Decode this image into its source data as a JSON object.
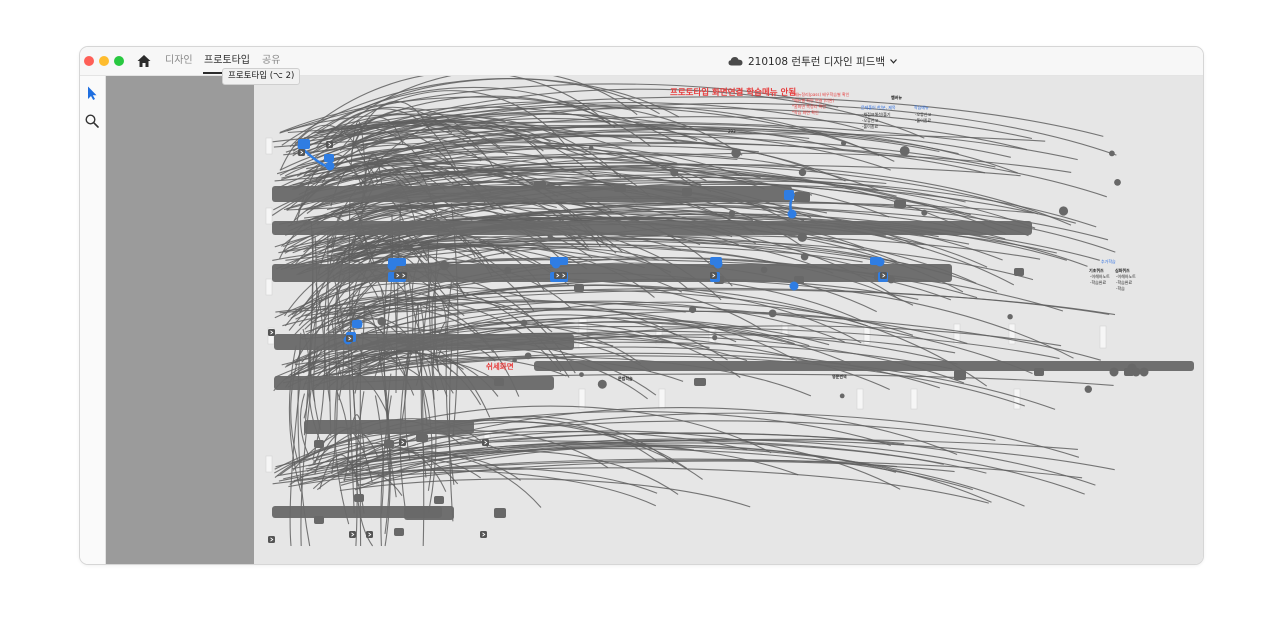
{
  "titlebar": {
    "tabs": [
      {
        "label": "디자인",
        "active": false
      },
      {
        "label": "프로토타입",
        "active": true
      },
      {
        "label": "공유",
        "active": false
      }
    ],
    "document_title": "210108 런투런 디자인 피드백",
    "tooltip": "프로토타입 (⌥ 2)"
  },
  "toolbar": {
    "tools": [
      {
        "icon": "select-arrow-icon",
        "active": true
      },
      {
        "icon": "zoom-icon",
        "active": false
      }
    ]
  },
  "canvas": {
    "heading": "프로토타입 화면연결 학습메뉴 안됨",
    "red_notes": [
      "*메뉴정리(pass) 배우학습별 확인",
      "*메뉴별 화면 연결 (미완)",
      "*홈화면 쪽정리 확인",
      "*학습 화면 확인"
    ],
    "menu_header": "햄버뉴",
    "col1_title": "문제풀어 한/분, 제목",
    "col1_items": [
      "-채점표해석/풀기",
      "-오류신고",
      "-풀이종료"
    ],
    "col2_title": "학습메뉴",
    "col2_items": [
      "-오류신고",
      "-풀이종료"
    ],
    "label_293": "293",
    "side_title": "추가학습",
    "side_col1_title": "기초퀴즈",
    "side_col1_items": [
      "-이해하노트",
      "-학습완료"
    ],
    "side_col2_title": "심화퀴즈",
    "side_col2_items": [
      "-이해하노트",
      "-학습완료",
      "-학습"
    ],
    "red_label": "쉬세화면",
    "bottom_label_1": "문법학습",
    "bottom_label_2": "영문번역"
  },
  "colors": {
    "canvas_bg": "#e6e6e6",
    "panel_bg": "#9b9b9b",
    "wire": "#5f5f5f",
    "node": "#686868",
    "highlight": "#2f7de3",
    "annotation_red": "#e63c3c",
    "annotation_blue": "#2d6fe3"
  }
}
